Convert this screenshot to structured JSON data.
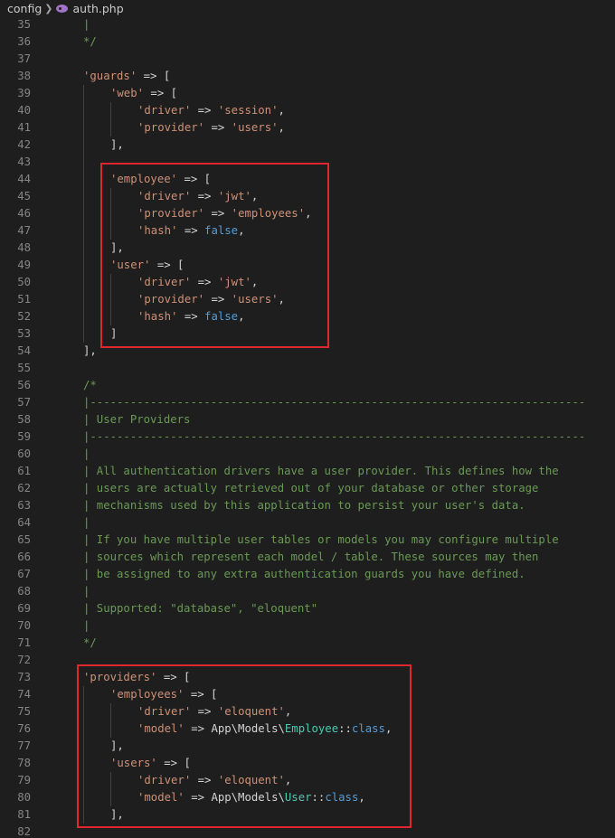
{
  "breadcrumb": {
    "folder": "config",
    "file": "auth.php"
  },
  "colors": {
    "background": "#1e1e1e",
    "string": "#ce9178",
    "keyword": "#569cd6",
    "comment": "#6a9955",
    "type": "#4ec9b0",
    "line_number": "#858585",
    "highlight": "#e0262f"
  },
  "editor": {
    "lines": [
      {
        "n": "35",
        "indent": 1,
        "tokens": [
          [
            "c",
            "|"
          ]
        ]
      },
      {
        "n": "36",
        "indent": 1,
        "tokens": [
          [
            "c",
            "*/"
          ]
        ]
      },
      {
        "n": "37",
        "indent": 0,
        "tokens": []
      },
      {
        "n": "38",
        "indent": 1,
        "tokens": [
          [
            "s",
            "'guards'"
          ],
          [
            "o",
            " => ["
          ]
        ]
      },
      {
        "n": "39",
        "indent": 2,
        "tokens": [
          [
            "s",
            "'web'"
          ],
          [
            "o",
            " => ["
          ]
        ]
      },
      {
        "n": "40",
        "indent": 3,
        "tokens": [
          [
            "s",
            "'driver'"
          ],
          [
            "o",
            " => "
          ],
          [
            "s",
            "'session'"
          ],
          [
            "o",
            ","
          ]
        ]
      },
      {
        "n": "41",
        "indent": 3,
        "tokens": [
          [
            "s",
            "'provider'"
          ],
          [
            "o",
            " => "
          ],
          [
            "s",
            "'users'"
          ],
          [
            "o",
            ","
          ]
        ]
      },
      {
        "n": "42",
        "indent": 2,
        "tokens": [
          [
            "o",
            "],"
          ]
        ]
      },
      {
        "n": "43",
        "indent": 0,
        "tokens": []
      },
      {
        "n": "44",
        "indent": 2,
        "tokens": [
          [
            "s",
            "'employee'"
          ],
          [
            "o",
            " => ["
          ]
        ]
      },
      {
        "n": "45",
        "indent": 3,
        "tokens": [
          [
            "s",
            "'driver'"
          ],
          [
            "o",
            " => "
          ],
          [
            "s",
            "'jwt'"
          ],
          [
            "o",
            ","
          ]
        ]
      },
      {
        "n": "46",
        "indent": 3,
        "tokens": [
          [
            "s",
            "'provider'"
          ],
          [
            "o",
            " => "
          ],
          [
            "s",
            "'employees'"
          ],
          [
            "o",
            ","
          ]
        ]
      },
      {
        "n": "47",
        "indent": 3,
        "tokens": [
          [
            "s",
            "'hash'"
          ],
          [
            "o",
            " => "
          ],
          [
            "k",
            "false"
          ],
          [
            "o",
            ","
          ]
        ]
      },
      {
        "n": "48",
        "indent": 2,
        "tokens": [
          [
            "o",
            "],"
          ]
        ]
      },
      {
        "n": "49",
        "indent": 2,
        "tokens": [
          [
            "s",
            "'user'"
          ],
          [
            "o",
            " => ["
          ]
        ]
      },
      {
        "n": "50",
        "indent": 3,
        "tokens": [
          [
            "s",
            "'driver'"
          ],
          [
            "o",
            " => "
          ],
          [
            "s",
            "'jwt'"
          ],
          [
            "o",
            ","
          ]
        ]
      },
      {
        "n": "51",
        "indent": 3,
        "tokens": [
          [
            "s",
            "'provider'"
          ],
          [
            "o",
            " => "
          ],
          [
            "s",
            "'users'"
          ],
          [
            "o",
            ","
          ]
        ]
      },
      {
        "n": "52",
        "indent": 3,
        "tokens": [
          [
            "s",
            "'hash'"
          ],
          [
            "o",
            " => "
          ],
          [
            "k",
            "false"
          ],
          [
            "o",
            ","
          ]
        ]
      },
      {
        "n": "53",
        "indent": 2,
        "tokens": [
          [
            "o",
            "]"
          ]
        ]
      },
      {
        "n": "54",
        "indent": 1,
        "tokens": [
          [
            "o",
            "],"
          ]
        ]
      },
      {
        "n": "55",
        "indent": 0,
        "tokens": []
      },
      {
        "n": "56",
        "indent": 1,
        "tokens": [
          [
            "c",
            "/*"
          ]
        ]
      },
      {
        "n": "57",
        "indent": 1,
        "tokens": [
          [
            "c",
            "|--------------------------------------------------------------------------"
          ]
        ]
      },
      {
        "n": "58",
        "indent": 1,
        "tokens": [
          [
            "c",
            "| User Providers"
          ]
        ]
      },
      {
        "n": "59",
        "indent": 1,
        "tokens": [
          [
            "c",
            "|--------------------------------------------------------------------------"
          ]
        ]
      },
      {
        "n": "60",
        "indent": 1,
        "tokens": [
          [
            "c",
            "|"
          ]
        ]
      },
      {
        "n": "61",
        "indent": 1,
        "tokens": [
          [
            "c",
            "| All authentication drivers have a user provider. This defines how the"
          ]
        ]
      },
      {
        "n": "62",
        "indent": 1,
        "tokens": [
          [
            "c",
            "| users are actually retrieved out of your database or other storage"
          ]
        ]
      },
      {
        "n": "63",
        "indent": 1,
        "tokens": [
          [
            "c",
            "| mechanisms used by this application to persist your user's data."
          ]
        ]
      },
      {
        "n": "64",
        "indent": 1,
        "tokens": [
          [
            "c",
            "|"
          ]
        ]
      },
      {
        "n": "65",
        "indent": 1,
        "tokens": [
          [
            "c",
            "| If you have multiple user tables or models you may configure multiple"
          ]
        ]
      },
      {
        "n": "66",
        "indent": 1,
        "tokens": [
          [
            "c",
            "| sources which represent each model / table. These sources may then"
          ]
        ]
      },
      {
        "n": "67",
        "indent": 1,
        "tokens": [
          [
            "c",
            "| be assigned to any extra authentication guards you have defined."
          ]
        ]
      },
      {
        "n": "68",
        "indent": 1,
        "tokens": [
          [
            "c",
            "|"
          ]
        ]
      },
      {
        "n": "69",
        "indent": 1,
        "tokens": [
          [
            "c",
            "| Supported: \"database\", \"eloquent\""
          ]
        ]
      },
      {
        "n": "70",
        "indent": 1,
        "tokens": [
          [
            "c",
            "|"
          ]
        ]
      },
      {
        "n": "71",
        "indent": 1,
        "tokens": [
          [
            "c",
            "*/"
          ]
        ]
      },
      {
        "n": "72",
        "indent": 0,
        "tokens": []
      },
      {
        "n": "73",
        "indent": 1,
        "tokens": [
          [
            "s",
            "'providers'"
          ],
          [
            "o",
            " => ["
          ]
        ]
      },
      {
        "n": "74",
        "indent": 2,
        "tokens": [
          [
            "s",
            "'employees'"
          ],
          [
            "o",
            " => ["
          ]
        ]
      },
      {
        "n": "75",
        "indent": 3,
        "tokens": [
          [
            "s",
            "'driver'"
          ],
          [
            "o",
            " => "
          ],
          [
            "s",
            "'eloquent'"
          ],
          [
            "o",
            ","
          ]
        ]
      },
      {
        "n": "76",
        "indent": 3,
        "tokens": [
          [
            "s",
            "'model'"
          ],
          [
            "o",
            " => App\\Models\\"
          ],
          [
            "t",
            "Employee"
          ],
          [
            "o",
            "::"
          ],
          [
            "k",
            "class"
          ],
          [
            "o",
            ","
          ]
        ]
      },
      {
        "n": "77",
        "indent": 2,
        "tokens": [
          [
            "o",
            "],"
          ]
        ]
      },
      {
        "n": "78",
        "indent": 2,
        "tokens": [
          [
            "s",
            "'users'"
          ],
          [
            "o",
            " => ["
          ]
        ]
      },
      {
        "n": "79",
        "indent": 3,
        "tokens": [
          [
            "s",
            "'driver'"
          ],
          [
            "o",
            " => "
          ],
          [
            "s",
            "'eloquent'"
          ],
          [
            "o",
            ","
          ]
        ]
      },
      {
        "n": "80",
        "indent": 3,
        "tokens": [
          [
            "s",
            "'model'"
          ],
          [
            "o",
            " => App\\Models\\"
          ],
          [
            "t",
            "User"
          ],
          [
            "o",
            "::"
          ],
          [
            "k",
            "class"
          ],
          [
            "o",
            ","
          ]
        ]
      },
      {
        "n": "81",
        "indent": 2,
        "tokens": [
          [
            "o",
            "],"
          ]
        ]
      },
      {
        "n": "82",
        "indent": 0,
        "tokens": []
      }
    ]
  }
}
